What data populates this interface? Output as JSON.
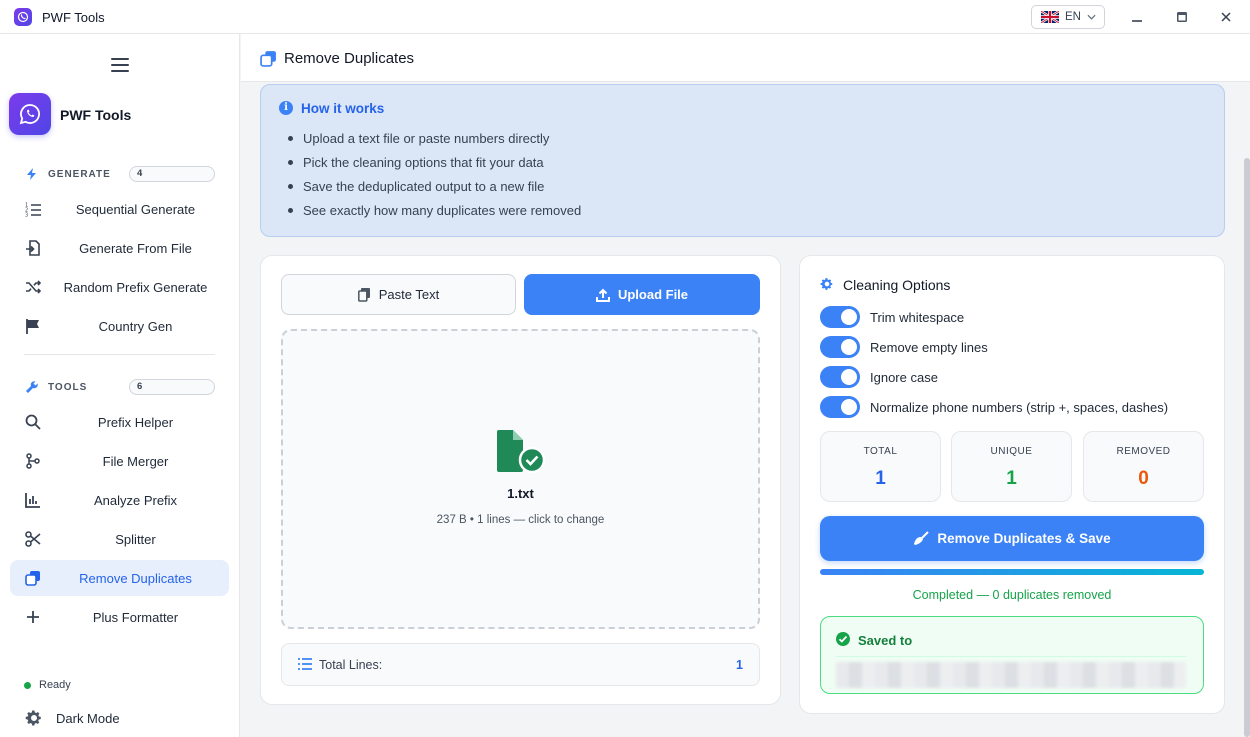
{
  "window": {
    "title": "PWF Tools",
    "language": "EN"
  },
  "sidebar": {
    "brand": "PWF Tools",
    "sections": [
      {
        "label": "GENERATE",
        "count": "4"
      },
      {
        "label": "TOOLS",
        "count": "6"
      }
    ],
    "generate_items": [
      {
        "label": "Sequential Generate",
        "icon": "list-ordered-icon"
      },
      {
        "label": "Generate From File",
        "icon": "file-import-icon"
      },
      {
        "label": "Random Prefix Generate",
        "icon": "shuffle-icon"
      },
      {
        "label": "Country Gen",
        "icon": "flag-icon"
      }
    ],
    "tool_items": [
      {
        "label": "Prefix Helper",
        "icon": "search-icon"
      },
      {
        "label": "File Merger",
        "icon": "merge-icon"
      },
      {
        "label": "Analyze Prefix",
        "icon": "chart-icon"
      },
      {
        "label": "Splitter",
        "icon": "scissors-icon"
      },
      {
        "label": "Remove Duplicates",
        "icon": "copy-icon",
        "active": true
      },
      {
        "label": "Plus Formatter",
        "icon": "plus-icon"
      }
    ],
    "status": "Ready",
    "dark_mode": "Dark Mode"
  },
  "header": {
    "title": "Remove Duplicates"
  },
  "how_it_works": {
    "title": "How it works",
    "steps": [
      "Upload a text file or paste numbers directly",
      "Pick the cleaning options that fit your data",
      "Save the deduplicated output to a new file",
      "See exactly how many duplicates were removed"
    ]
  },
  "input": {
    "tabs": {
      "paste": "Paste Text",
      "upload": "Upload File"
    },
    "file": {
      "name": "1.txt",
      "meta": "237 B • 1 lines — click to change"
    },
    "total_lines_label": "Total Lines:",
    "total_lines_value": "1"
  },
  "options": {
    "title": "Cleaning Options",
    "toggles": [
      {
        "label": "Trim whitespace",
        "on": true
      },
      {
        "label": "Remove empty lines",
        "on": true
      },
      {
        "label": "Ignore case",
        "on": true
      },
      {
        "label": "Normalize phone numbers (strip +, spaces, dashes)",
        "on": true
      }
    ],
    "stats": {
      "total": {
        "label": "TOTAL",
        "value": "1",
        "color": "#2563eb"
      },
      "unique": {
        "label": "UNIQUE",
        "value": "1",
        "color": "#16a34a"
      },
      "removed": {
        "label": "REMOVED",
        "value": "0",
        "color": "#ea580c"
      }
    },
    "save_button": "Remove Duplicates & Save",
    "progress": 1.0,
    "completed": "Completed — 0 duplicates removed",
    "saved_to": "Saved to"
  },
  "colors": {
    "accent": "#3b82f6",
    "success": "#16a34a",
    "warning": "#ea580c"
  }
}
